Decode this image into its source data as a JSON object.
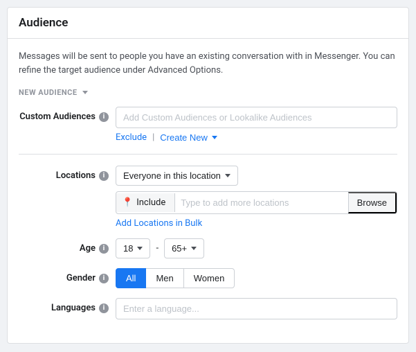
{
  "card": {
    "title": "Audience",
    "description": "Messages will be sent to people you have an existing conversation with in Messenger. You can refine the target audience under Advanced Options.",
    "new_audience_label": "NEW AUDIENCE",
    "custom_audiences": {
      "label": "Custom Audiences",
      "placeholder": "Add Custom Audiences or Lookalike Audiences",
      "exclude_link": "Exclude",
      "create_new_label": "Create New"
    },
    "locations": {
      "label": "Locations",
      "dropdown_value": "Everyone in this location",
      "include_label": "Include",
      "location_placeholder": "Type to add more locations",
      "browse_label": "Browse",
      "add_bulk_label": "Add Locations in Bulk"
    },
    "age": {
      "label": "Age",
      "min_value": "18",
      "max_value": "65+",
      "dash": "-"
    },
    "gender": {
      "label": "Gender",
      "options": [
        "All",
        "Men",
        "Women"
      ],
      "active": "All"
    },
    "languages": {
      "label": "Languages",
      "placeholder": "Enter a language..."
    }
  }
}
